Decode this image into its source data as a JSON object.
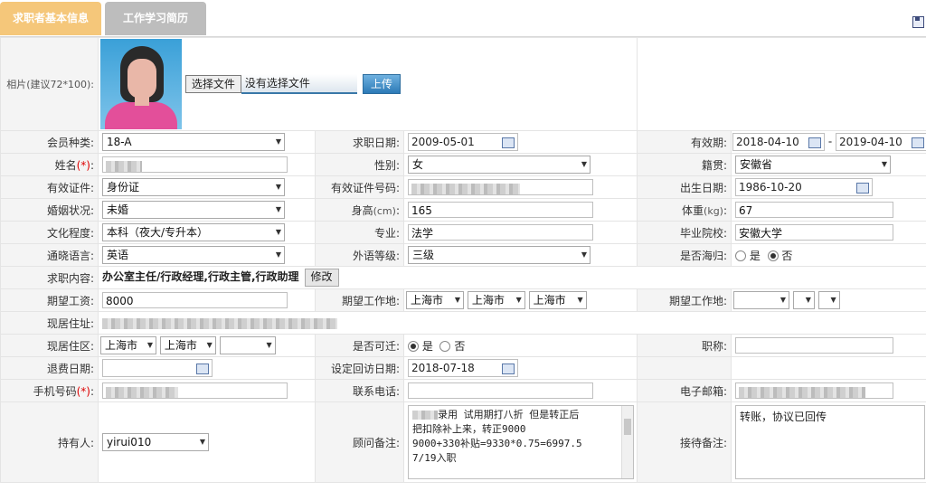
{
  "tabs": [
    "求职者基本信息",
    "工作学习简历"
  ],
  "photo": {
    "label": "相片(建议72*100):",
    "choose_file": "选择文件",
    "no_file": "没有选择文件",
    "upload": "上传"
  },
  "fields": {
    "member_type": {
      "label": "会员种类:",
      "value": "18-A"
    },
    "apply_date": {
      "label": "求职日期:",
      "value": "2009-05-01"
    },
    "valid_period": {
      "label": "有效期:",
      "from": "2018-04-10",
      "sep": "-",
      "to": "2019-04-10"
    },
    "name": {
      "label": "姓名",
      "req": "(*)",
      "colon": ":"
    },
    "gender": {
      "label": "性别:",
      "value": "女"
    },
    "native": {
      "label": "籍贯:",
      "value": "安徽省"
    },
    "id_type": {
      "label": "有效证件:",
      "value": "身份证"
    },
    "id_number": {
      "label": "有效证件号码:"
    },
    "birth": {
      "label": "出生日期:",
      "value": "1986-10-20"
    },
    "marital": {
      "label": "婚姻状况:",
      "value": "未婚"
    },
    "height": {
      "label": "身高",
      "unit": "(cm)",
      "colon": ":",
      "value": "165"
    },
    "weight": {
      "label": "体重",
      "unit": "(kg)",
      "colon": ":",
      "value": "67"
    },
    "education": {
      "label": "文化程度:",
      "value": "本科（夜大/专升本）"
    },
    "major": {
      "label": "专业:",
      "value": "法学"
    },
    "school": {
      "label": "毕业院校:",
      "value": "安徽大学"
    },
    "language": {
      "label": "通晓语言:",
      "value": "英语"
    },
    "lang_level": {
      "label": "外语等级:",
      "value": "三级"
    },
    "overseas": {
      "label": "是否海归:",
      "yes": "是",
      "no": "否"
    },
    "job_content": {
      "label": "求职内容:",
      "value": "办公室主任/行政经理,行政主管,行政助理",
      "edit": "修改"
    },
    "salary": {
      "label": "期望工资:",
      "value": "8000"
    },
    "work_place1": {
      "label": "期望工作地:",
      "v1": "上海市",
      "v2": "上海市",
      "v3": "上海市"
    },
    "work_place2": {
      "label": "期望工作地:"
    },
    "address": {
      "label": "现居住址:"
    },
    "district": {
      "label": "现居住区:",
      "v1": "上海市",
      "v2": "上海市"
    },
    "relocate": {
      "label": "是否可迁:",
      "yes": "是",
      "no": "否"
    },
    "refund_date": {
      "label": "退费日期:"
    },
    "callback_date": {
      "label": "设定回访日期:",
      "value": "2018-07-18"
    },
    "title": {
      "label": "职称:"
    },
    "mobile": {
      "label": "手机号码",
      "req": "(*)",
      "colon": ":"
    },
    "phone": {
      "label": "联系电话:"
    },
    "email": {
      "label": "电子邮箱:"
    },
    "holder": {
      "label": "持有人:",
      "value": "yirui010"
    },
    "consultant_note": {
      "label": "顾问备注:",
      "lines": [
        "录用 试用期打八折 但是转正后",
        "把扣除补上来，转正9000",
        "9000+330补贴=9330*0.75=6997.5",
        "7/19入职"
      ]
    },
    "reception_note": {
      "label": "接待备注:",
      "value": "转账，协议已回传"
    }
  }
}
